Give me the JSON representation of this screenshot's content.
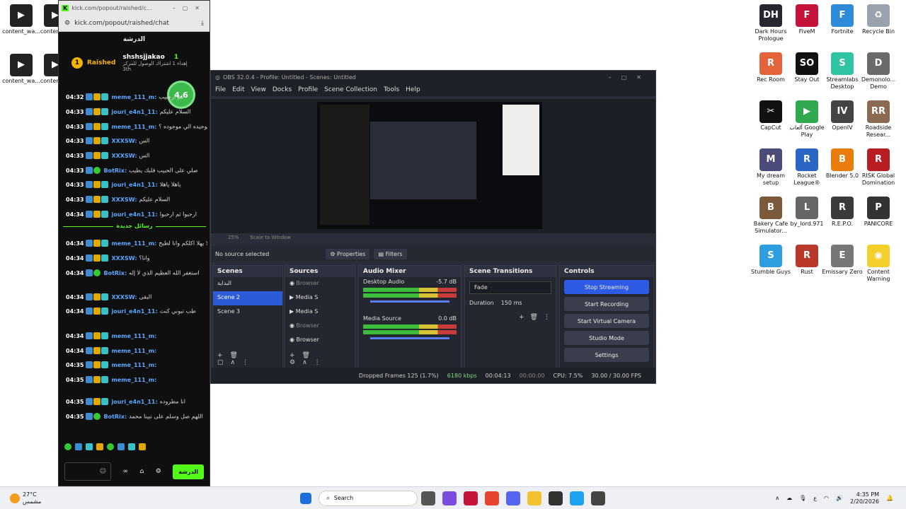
{
  "desktop_left": [
    {
      "label": "content_wa...",
      "x": "c"
    },
    {
      "label": "content_...",
      "x": "c"
    },
    {
      "label": "content_wa...",
      "x": "c"
    },
    {
      "label": "content_...",
      "x": "c"
    }
  ],
  "desktop_right": [
    {
      "label": "Dark Hours Prologue",
      "color": "#2a2630",
      "glyph": "DH"
    },
    {
      "label": "FiveM",
      "color": "#c4123a",
      "glyph": "F"
    },
    {
      "label": "Fortnite",
      "color": "#2e8bd8",
      "glyph": "F"
    },
    {
      "label": "Recycle Bin",
      "color": "#9aa3ad",
      "glyph": "♻"
    },
    {
      "label": "Rec Room",
      "color": "#e5633a",
      "glyph": "R"
    },
    {
      "label": "Stay Out",
      "color": "#111111",
      "glyph": "SO"
    },
    {
      "label": "Streamlabs Desktop",
      "color": "#31c3a2",
      "glyph": "S"
    },
    {
      "label": "Demonolo... Demo",
      "color": "#6a6a6a",
      "glyph": "D"
    },
    {
      "label": "CapCut",
      "color": "#111111",
      "glyph": "✂"
    },
    {
      "label": "ألعاب Google Play",
      "color": "#2fa84f",
      "glyph": "▶"
    },
    {
      "label": "OpenIV",
      "color": "#444444",
      "glyph": "IV"
    },
    {
      "label": "Roadside Resear...",
      "color": "#8a6a50",
      "glyph": "RR"
    },
    {
      "label": "My dream setup",
      "color": "#4b4c7a",
      "glyph": "M"
    },
    {
      "label": "Rocket League®",
      "color": "#2b66c4",
      "glyph": "R"
    },
    {
      "label": "Blender 5.0",
      "color": "#e87d0d",
      "glyph": "B"
    },
    {
      "label": "RISK Global Domination",
      "color": "#b81d24",
      "glyph": "R"
    },
    {
      "label": "Bakery Cafe Simulator...",
      "color": "#7a5a3a",
      "glyph": "B"
    },
    {
      "label": "by_lord.971",
      "color": "#666666",
      "glyph": "L"
    },
    {
      "label": "R.E.P.O.",
      "color": "#3a3a3a",
      "glyph": "R"
    },
    {
      "label": "PANICORE",
      "color": "#333333",
      "glyph": "P"
    },
    {
      "label": "Stumble Guys",
      "color": "#2d9fe0",
      "glyph": "S"
    },
    {
      "label": "Rust",
      "color": "#b8382a",
      "glyph": "R"
    },
    {
      "label": "Emissary Zero",
      "color": "#777777",
      "glyph": "E"
    },
    {
      "label": "Content Warning",
      "color": "#f3d02b",
      "glyph": "◉"
    }
  ],
  "chat": {
    "url_title": "kick.com/popout/raished/c...",
    "url": "kick.com/popout/raished/chat",
    "room": "الدرشة",
    "pinned_name": "Raished",
    "pinned_count": "1",
    "pinned_user": "shshsjjakao",
    "pinned_text": "إهداء 1 اشتراك الوصول للمركز",
    "pinned_rank": "3th",
    "rating": "4.6",
    "divider": "رسائل جديدة",
    "send": "الدرشة",
    "messages": [
      {
        "time": "04:32",
        "user": "meme_111_m:",
        "text": "كم ارحبيب"
      },
      {
        "time": "04:33",
        "user": "jouri_e4n1_11:",
        "text": "السلام عليكم"
      },
      {
        "time": "04:33",
        "user": "meme_111_m:",
        "text": "أنا الوحيده الي موجوده ؟"
      },
      {
        "time": "04:33",
        "user": "XXXSW:",
        "text": "الس"
      },
      {
        "time": "04:33",
        "user": "XXXSW:",
        "text": "الس"
      },
      {
        "time": "04:33",
        "user": "BotRix:",
        "text": "صلي على الحبيب قلبك يطيب"
      },
      {
        "time": "04:33",
        "user": "jouri_e4n1_11:",
        "text": "ياهلا ياهلا"
      },
      {
        "time": "04:33",
        "user": "XXXSW:",
        "text": "السلام عليكم"
      },
      {
        "time": "04:34",
        "user": "jouri_e4n1_11:",
        "text": "ارحبوا ثم ارحبوا"
      },
      {
        "time": "04:34",
        "user": "meme_111_m:",
        "text": "يهلا يهلا اكلكم وانا لطيخ"
      },
      {
        "time": "04:34",
        "user": "XXXSW:",
        "text": "وانا؟"
      },
      {
        "time": "04:34",
        "user": "BotRix:",
        "text": "استغفر الله العظيم الذي لا إله"
      },
      {
        "time": "04:34",
        "user": "XXXSW:",
        "text": "البقى"
      },
      {
        "time": "04:34",
        "user": "jouri_e4n1_11:",
        "text": "طب تبوني كنت"
      },
      {
        "time": "04:34",
        "user": "meme_111_m:",
        "text": ""
      },
      {
        "time": "04:34",
        "user": "meme_111_m:",
        "text": ""
      },
      {
        "time": "04:35",
        "user": "meme_111_m:",
        "text": ""
      },
      {
        "time": "04:35",
        "user": "meme_111_m:",
        "text": ""
      },
      {
        "time": "04:35",
        "user": "jouri_e4n1_11:",
        "text": "انا مطروده"
      },
      {
        "time": "04:35",
        "user": "BotRix:",
        "text": "اللهم صل وسلم على نبينا محمد"
      }
    ]
  },
  "obs": {
    "title": "OBS 32.0.4 - Profile: Untitled - Scenes: Untitled",
    "menu": [
      "File",
      "Edit",
      "View",
      "Docks",
      "Profile",
      "Scene Collection",
      "Tools",
      "Help"
    ],
    "zoom": "25%",
    "scale": "Scale to Window",
    "no_source": "No source selected",
    "properties": "Properties",
    "filters": "Filters",
    "docks": {
      "scenes": "Scenes",
      "sources": "Sources",
      "mixer": "Audio Mixer",
      "transitions": "Scene Transitions",
      "controls": "Controls"
    },
    "scenes": [
      "البداية",
      "Scene 2",
      "Scene 3"
    ],
    "sources": [
      "Browser",
      "Media S",
      "Media S",
      "Browser",
      "Browser"
    ],
    "mixer": [
      {
        "name": "Desktop Audio",
        "db": "-5.7 dB"
      },
      {
        "name": "Media Source",
        "db": "0.0 dB"
      }
    ],
    "transition": "Fade",
    "duration_label": "Duration",
    "duration": "150 ms",
    "controls": [
      "Stop Streaming",
      "Start Recording",
      "Start Virtual Camera",
      "Studio Mode",
      "Settings"
    ],
    "status": {
      "dropped": "Dropped Frames 125 (1.7%)",
      "kbps": "6180 kbps",
      "stream_time": "00:04:13",
      "rec_time": "00:00:00",
      "cpu": "CPU: 7.5%",
      "fps": "30.00 / 30.00 FPS"
    }
  },
  "taskbar": {
    "weather_temp": "27°C",
    "weather_desc": "مشمس",
    "search": "Search",
    "time": "4:35 PM",
    "date": "2/20/2026",
    "lang": "ع"
  }
}
